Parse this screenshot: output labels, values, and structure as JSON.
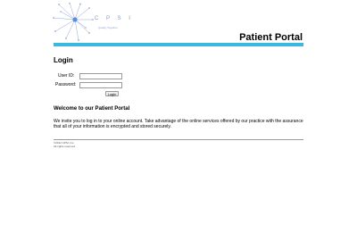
{
  "logo": {
    "brand_text": "C P S I",
    "tagline": "Quality Together",
    "accent_color": "#5b8ed6"
  },
  "header": {
    "title": "Patient Portal",
    "bar_color": "#3ab8e0"
  },
  "login": {
    "heading": "Login",
    "user_id_label": "User ID:",
    "user_id_value": "",
    "password_label": "Password:",
    "password_value": "",
    "submit_label": "Login"
  },
  "welcome": {
    "heading": "Welcome to our Patient Portal",
    "body": "We invite you to log in to your online account. Take advantage of the online services offered by our practice with the assurance that all of your information is encrypted and stored securely."
  },
  "footer": {
    "copyright_line1": "©2012 CPSI, Inc.",
    "copyright_line2": "All rights reserved."
  }
}
